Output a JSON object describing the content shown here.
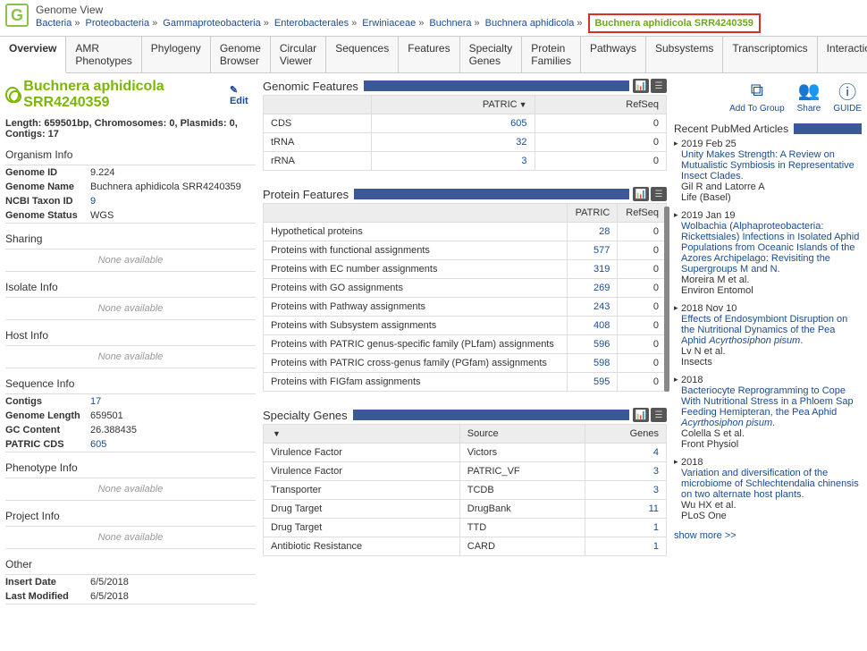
{
  "header": {
    "title": "Genome View",
    "breadcrumb": [
      "Bacteria",
      "Proteobacteria",
      "Gammaproteobacteria",
      "Enterobacterales",
      "Erwiniaceae",
      "Buchnera",
      "Buchnera aphidicola"
    ],
    "breadcrumb_last": "Buchnera aphidicola SRR4240359"
  },
  "tabs": [
    "Overview",
    "AMR Phenotypes",
    "Phylogeny",
    "Genome Browser",
    "Circular Viewer",
    "Sequences",
    "Features",
    "Specialty Genes",
    "Protein Families",
    "Pathways",
    "Subsystems",
    "Transcriptomics",
    "Interactions"
  ],
  "organism": {
    "name": "Buchnera aphidicola SRR4240359",
    "edit_label": "Edit",
    "length_line": "Length: 659501bp, Chromosomes: 0, Plasmids: 0, Contigs: 17",
    "none_available": "None available",
    "sections": {
      "organism_info": "Organism Info",
      "sharing": "Sharing",
      "isolate_info": "Isolate Info",
      "host_info": "Host Info",
      "sequence_info": "Sequence Info",
      "phenotype_info": "Phenotype Info",
      "project_info": "Project Info",
      "other": "Other"
    },
    "org_rows": [
      {
        "label": "Genome ID",
        "value": "9.224",
        "link": false
      },
      {
        "label": "Genome Name",
        "value": "Buchnera aphidicola SRR4240359",
        "link": false
      },
      {
        "label": "NCBI Taxon ID",
        "value": "9",
        "link": true
      },
      {
        "label": "Genome Status",
        "value": "WGS",
        "link": false
      }
    ],
    "seq_rows": [
      {
        "label": "Contigs",
        "value": "17",
        "link": true
      },
      {
        "label": "Genome Length",
        "value": "659501",
        "link": false
      },
      {
        "label": "GC Content",
        "value": "26.388435",
        "link": false
      },
      {
        "label": "PATRIC CDS",
        "value": "605",
        "link": true
      }
    ],
    "other_rows": [
      {
        "label": "Insert Date",
        "value": "6/5/2018"
      },
      {
        "label": "Last Modified",
        "value": "6/5/2018"
      }
    ]
  },
  "genomic_features": {
    "title": "Genomic Features",
    "headers": [
      "",
      "PATRIC",
      "RefSeq"
    ],
    "rows": [
      {
        "name": "CDS",
        "patric": "605",
        "refseq": "0"
      },
      {
        "name": "tRNA",
        "patric": "32",
        "refseq": "0"
      },
      {
        "name": "rRNA",
        "patric": "3",
        "refseq": "0"
      }
    ]
  },
  "protein_features": {
    "title": "Protein Features",
    "headers": [
      "",
      "PATRIC",
      "RefSeq"
    ],
    "rows": [
      {
        "name": "Hypothetical proteins",
        "patric": "28",
        "refseq": "0"
      },
      {
        "name": "Proteins with functional assignments",
        "patric": "577",
        "refseq": "0"
      },
      {
        "name": "Proteins with EC number assignments",
        "patric": "319",
        "refseq": "0"
      },
      {
        "name": "Proteins with GO assignments",
        "patric": "269",
        "refseq": "0"
      },
      {
        "name": "Proteins with Pathway assignments",
        "patric": "243",
        "refseq": "0"
      },
      {
        "name": "Proteins with Subsystem assignments",
        "patric": "408",
        "refseq": "0"
      },
      {
        "name": "Proteins with PATRIC genus-specific family (PLfam) assignments",
        "patric": "596",
        "refseq": "0"
      },
      {
        "name": "Proteins with PATRIC cross-genus family (PGfam) assignments",
        "patric": "598",
        "refseq": "0"
      },
      {
        "name": "Proteins with FIGfam assignments",
        "patric": "595",
        "refseq": "0"
      }
    ]
  },
  "specialty_genes": {
    "title": "Specialty Genes",
    "headers": [
      "",
      "Source",
      "Genes"
    ],
    "rows": [
      {
        "name": "Virulence Factor",
        "source": "Victors",
        "genes": "4"
      },
      {
        "name": "Virulence Factor",
        "source": "PATRIC_VF",
        "genes": "3"
      },
      {
        "name": "Transporter",
        "source": "TCDB",
        "genes": "3"
      },
      {
        "name": "Drug Target",
        "source": "DrugBank",
        "genes": "11"
      },
      {
        "name": "Drug Target",
        "source": "TTD",
        "genes": "1"
      },
      {
        "name": "Antibiotic Resistance",
        "source": "CARD",
        "genes": "1"
      }
    ]
  },
  "actions": {
    "add_to_group": "Add To Group",
    "share": "Share",
    "guide": "GUIDE"
  },
  "pubmed": {
    "title": "Recent PubMed Articles",
    "show_more": "show more >>",
    "articles": [
      {
        "date": "2019 Feb 25",
        "title": "Unity Makes Strength: A Review on Mutualistic Symbiosis in Representative Insect Clades.",
        "authors": "Gil R and Latorre A",
        "journal": "Life (Basel)"
      },
      {
        "date": "2019 Jan 19",
        "title": "Wolbachia (Alphaproteobacteria: Rickettsiales) Infections in Isolated Aphid Populations from Oceanic Islands of the Azores Archipelago: Revisiting the Supergroups M and N.",
        "authors": "Moreira M et al.",
        "journal": "Environ Entomol"
      },
      {
        "date": "2018 Nov 10",
        "title": "Effects of Endosymbiont Disruption on the Nutritional Dynamics of the Pea Aphid <i>Acyrthosiphon pisum</i>.",
        "authors": "Lv N et al.",
        "journal": "Insects"
      },
      {
        "date": "2018",
        "title": "Bacteriocyte Reprogramming to Cope With Nutritional Stress in a Phloem Sap Feeding Hemipteran, the Pea Aphid <i>Acyrthosiphon pisum</i>.",
        "authors": "Colella S et al.",
        "journal": "Front Physiol"
      },
      {
        "date": "2018",
        "title": "Variation and diversification of the microbiome of Schlechtendalia chinensis on two alternate host plants.",
        "authors": "Wu HX et al.",
        "journal": "PLoS One"
      }
    ]
  }
}
